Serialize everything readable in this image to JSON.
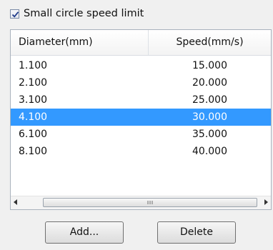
{
  "checkbox": {
    "label": "Small circle speed limit",
    "checked": true
  },
  "table": {
    "columns": [
      "Diameter(mm)",
      "Speed(mm/s)"
    ],
    "rows": [
      {
        "diameter": "1.100",
        "speed": "15.000",
        "selected": false
      },
      {
        "diameter": "2.100",
        "speed": "20.000",
        "selected": false
      },
      {
        "diameter": "3.100",
        "speed": "25.000",
        "selected": false
      },
      {
        "diameter": "4.100",
        "speed": "30.000",
        "selected": true
      },
      {
        "diameter": "6.100",
        "speed": "35.000",
        "selected": false
      },
      {
        "diameter": "8.100",
        "speed": "40.000",
        "selected": false
      }
    ],
    "selection_color": "#3399ff"
  },
  "buttons": {
    "add": "Add...",
    "delete": "Delete"
  }
}
